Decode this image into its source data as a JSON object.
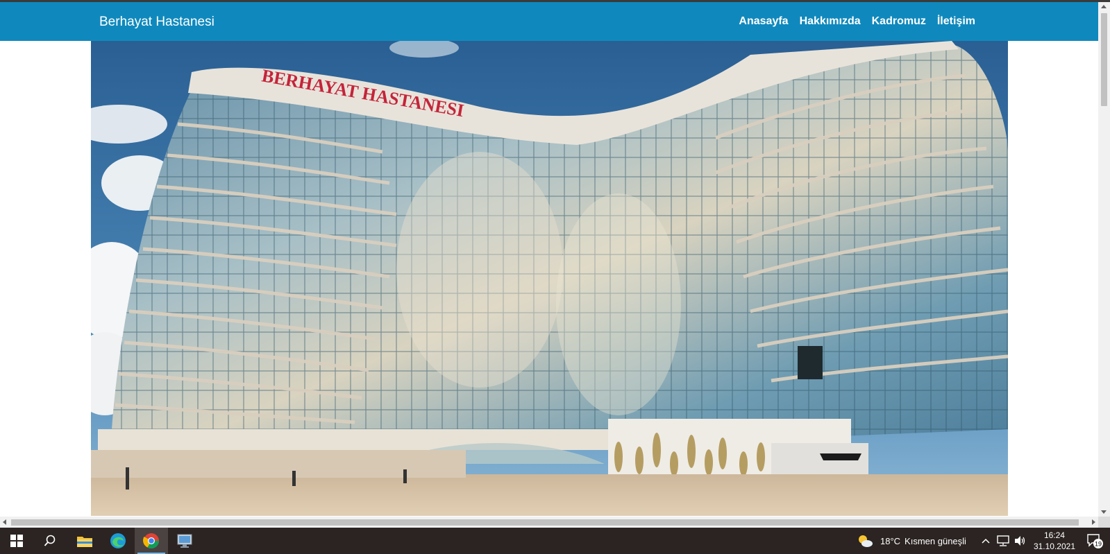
{
  "navbar": {
    "brand": "Berhayat Hastanesi",
    "links": [
      "Anasayfa",
      "Hakkımızda",
      "Kadromuz",
      "İletişim"
    ],
    "color": "#0f89bd"
  },
  "hero": {
    "sign_text": "BERHAYAT HASTANESI"
  },
  "taskbar": {
    "pinned": [
      "windows-start-icon",
      "search-icon",
      "file-explorer-icon",
      "edge-icon",
      "chrome-icon",
      "app-icon"
    ],
    "weather": {
      "temperature": "18°C",
      "condition": "Kısmen güneşli"
    },
    "clock": {
      "time": "16:24",
      "date": "31.10.2021"
    },
    "notification_count": "19"
  }
}
